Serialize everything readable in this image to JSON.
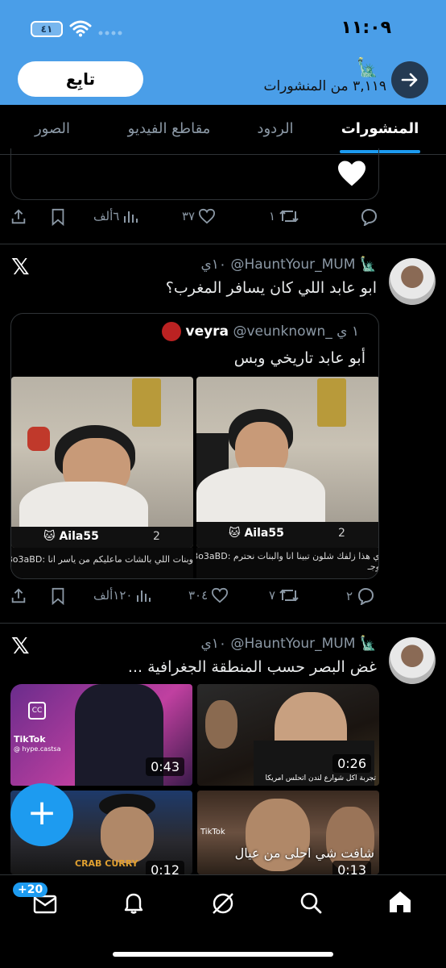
{
  "status_bar": {
    "time": "١١:٠٩",
    "battery": "٤١"
  },
  "profile_header": {
    "follow_label": "تابِع",
    "posts_count": "٣,١١٩ من المنشورات"
  },
  "tabs": [
    {
      "label": "المنشورات",
      "active": true
    },
    {
      "label": "الردود",
      "active": false
    },
    {
      "label": "مقاطع الفيديو",
      "active": false
    },
    {
      "label": "الصور",
      "active": false
    }
  ],
  "prev_post": {
    "views": "٦ألف",
    "likes": "٣٧",
    "retweets": "١",
    "replies": ""
  },
  "tweet1": {
    "handle": "@HauntYour_MUM",
    "time": "١٠ي",
    "text": "ابو عابد اللي كان يسافر المغرب؟",
    "quote": {
      "name": "veyra",
      "handle": "@veunknown_",
      "time": "١ ي",
      "text": "أبو عابد تاريخي وبس",
      "left_tag": "Aila55",
      "left_num": "2",
      "right_tag": "Aila55",
      "right_num": "2",
      "caption_left": "وبنات اللي بالشات ماعليكم من ياسر انا :Bo3aBD",
      "caption_right": "ي هذا زلفك شلون تبينا انا والبنات نحترم :Bo3aBD",
      "caption_right2": "وجـ"
    },
    "views": "١٢٠ألف",
    "likes": "٣٠٤",
    "retweets": "٧",
    "replies": "٢"
  },
  "tweet2": {
    "handle": "@HauntYour_MUM",
    "time": "١٠ي",
    "text": "غض البصر حسب المنطقة الجغرافية ...",
    "videos": [
      {
        "duration": "0:43",
        "overlay": "TikTok",
        "sub": "@ hype.castsa"
      },
      {
        "duration": "0:26",
        "overlay": "تجربة اكل شوارع لندن اتحلس امريكا",
        "sub": ""
      },
      {
        "duration": "0:12",
        "overlay": "CRAB CURRY",
        "sub": ""
      },
      {
        "duration": "0:13",
        "overlay": "شافت شي احلى من عيال",
        "sub": "TikTok"
      }
    ]
  },
  "fab": {
    "label": "+"
  },
  "nav": {
    "badge": "+20"
  },
  "colors": {
    "accent": "#1d9bf0",
    "header": "#4a9ee8",
    "bg": "#000000"
  }
}
